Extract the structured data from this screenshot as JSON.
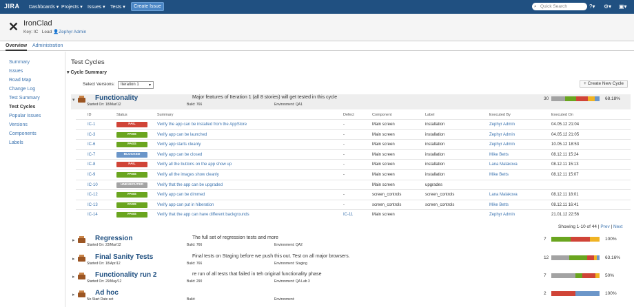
{
  "topbar": {
    "logo": "JIRA",
    "nav": [
      "Dashboards ▾",
      "Projects ▾",
      "Issues ▾",
      "Tests ▾"
    ],
    "create": "Create Issue",
    "search_placeholder": "Quick Search",
    "help_icon": "?▾",
    "settings_icon": "⚙▾",
    "user_icon": "▣▾"
  },
  "project": {
    "name": "IronClad",
    "key_label": "Key:",
    "key": "IC",
    "lead_label": "Lead",
    "lead": "Zephyr Admin"
  },
  "tabs": [
    "Overview",
    "Administration"
  ],
  "sidebar": [
    "Summary",
    "Issues",
    "Road Map",
    "Change Log",
    "Test Summary",
    "Test Cycles",
    "Popular Issues",
    "Versions",
    "Components",
    "Labels"
  ],
  "main": {
    "title": "Test Cycles",
    "section": "Cycle Summary",
    "select_label": "Select Versions:",
    "select_value": "Iteration 1",
    "new_cycle": "+ Create New Cycle"
  },
  "colors": {
    "pass": "#6aa51f",
    "fail": "#d04437",
    "blocked": "#6b96c9",
    "unexecuted": "#a3a3a3",
    "wip": "#f0b323"
  },
  "table_headers": [
    "ID",
    "Status",
    "Summary",
    "Defect",
    "Component",
    "Label",
    "Executed By",
    "Executed On"
  ],
  "tests": [
    {
      "id": "IC-1",
      "status": "FAIL",
      "summary": "Verify the app can be installed from the AppStore",
      "defect": "-",
      "component": "Main screen",
      "label": "installation",
      "by": "Zephyr Admin",
      "on": "04.05.12 21:04"
    },
    {
      "id": "IC-3",
      "status": "PASS",
      "summary": "Verify app can be launched",
      "defect": "-",
      "component": "Main screen",
      "label": "installation",
      "by": "Zephyr Admin",
      "on": "04.05.12 21:05"
    },
    {
      "id": "IC-6",
      "status": "PASS",
      "summary": "Verify app starts cleanly",
      "defect": "-",
      "component": "Main screen",
      "label": "installation",
      "by": "Zephyr Admin",
      "on": "10.05.12 18:53"
    },
    {
      "id": "IC-7",
      "status": "BLOCKED",
      "summary": "Verify app can be closed",
      "defect": "-",
      "component": "Main screen",
      "label": "installation",
      "by": "Mike Betts",
      "on": "08.12.11 15:24"
    },
    {
      "id": "IC-8",
      "status": "FAIL",
      "summary": "Verify all the buttons on the app show up",
      "defect": "-",
      "component": "Main screen",
      "label": "installation",
      "by": "Lana Malakova",
      "on": "08.12.11 15:13"
    },
    {
      "id": "IC-9",
      "status": "PASS",
      "summary": "Verify all the images show cleanly",
      "defect": "-",
      "component": "Main screen",
      "label": "installation",
      "by": "Mike Betts",
      "on": "08.12.11 15:07"
    },
    {
      "id": "IC-10",
      "status": "UNEXECUTED",
      "summary": "Verify that the app can be upgraded",
      "defect": "",
      "component": "Main screen",
      "label": "upgrades",
      "by": "",
      "on": ""
    },
    {
      "id": "IC-12",
      "status": "PASS",
      "summary": "Verify app can be dimmed",
      "defect": "-",
      "component": "screen_controls",
      "label": "screen_controls",
      "by": "Lana Malakova",
      "on": "08.12.11 18:01"
    },
    {
      "id": "IC-13",
      "status": "PASS",
      "summary": "Verify app can put in hiberation",
      "defect": "-",
      "component": "screen_controls",
      "label": "screen_controls",
      "by": "Mike Betts",
      "on": "08.12.11 16:41"
    },
    {
      "id": "IC-14",
      "status": "PASS",
      "summary": "Verify that the app can have different backgrounds",
      "defect": "IC-11",
      "component": "Main screen",
      "label": "",
      "by": "Zephyr Admin",
      "on": "21.01.12 22:56"
    }
  ],
  "showing": {
    "text": "Showing 1-10 of 44 |",
    "prev": "Prev",
    "sep": "|",
    "next": "Next"
  },
  "cycles": [
    {
      "name": "Functionality",
      "started": "Started On: 18/Mar/12",
      "desc": "Major features of Iteration 1 (all 8 stories) will get tested in this cycle",
      "build": "Build: 766",
      "env": "Environment: QA1",
      "count": "30",
      "pct": "68.18%",
      "bar": [
        [
          "#a3a3a3",
          0.28
        ],
        [
          "#6aa51f",
          0.24
        ],
        [
          "#d04437",
          0.24
        ],
        [
          "#f0b323",
          0.14
        ],
        [
          "#6b96c9",
          0.1
        ]
      ]
    },
    {
      "name": "Regression",
      "started": "Started On: 23/Mar/12",
      "desc": "The full set of regression tests and more",
      "build": "Build: 766",
      "env": "Environment: QA2",
      "count": "7",
      "pct": "100%",
      "bar": [
        [
          "#6aa51f",
          0.4
        ],
        [
          "#d04437",
          0.4
        ],
        [
          "#f0b323",
          0.2
        ]
      ]
    },
    {
      "name": "Final Sanity Tests",
      "started": "Started On: 18/Apr/12",
      "desc": "Final tests on Staging before we push this out. Test on all major browsers.",
      "build": "Build: 766",
      "env": "Environment: Staging",
      "count": "12",
      "pct": "63.16%",
      "bar": [
        [
          "#a3a3a3",
          0.37
        ],
        [
          "#6aa51f",
          0.37
        ],
        [
          "#d04437",
          0.14
        ],
        [
          "#f0b323",
          0.06
        ],
        [
          "#6b96c9",
          0.06
        ]
      ]
    },
    {
      "name": "Functionality run 2",
      "started": "Started On: 29/May/12",
      "desc": "re run of all tests that failed in teh original functionality phase",
      "build": "Build: 290",
      "env": "Environment: QA Lab 3",
      "count": "7",
      "pct": "50%",
      "bar": [
        [
          "#a3a3a3",
          0.5
        ],
        [
          "#6aa51f",
          0.14
        ],
        [
          "#d04437",
          0.28
        ],
        [
          "#f0b323",
          0.08
        ]
      ]
    },
    {
      "name": "Ad hoc",
      "started": "No Start Date set",
      "desc": "",
      "build": "Build:",
      "env": "Environment:",
      "count": "2",
      "pct": "100%",
      "bar": [
        [
          "#d04437",
          0.5
        ],
        [
          "#6b96c9",
          0.5
        ]
      ]
    }
  ]
}
